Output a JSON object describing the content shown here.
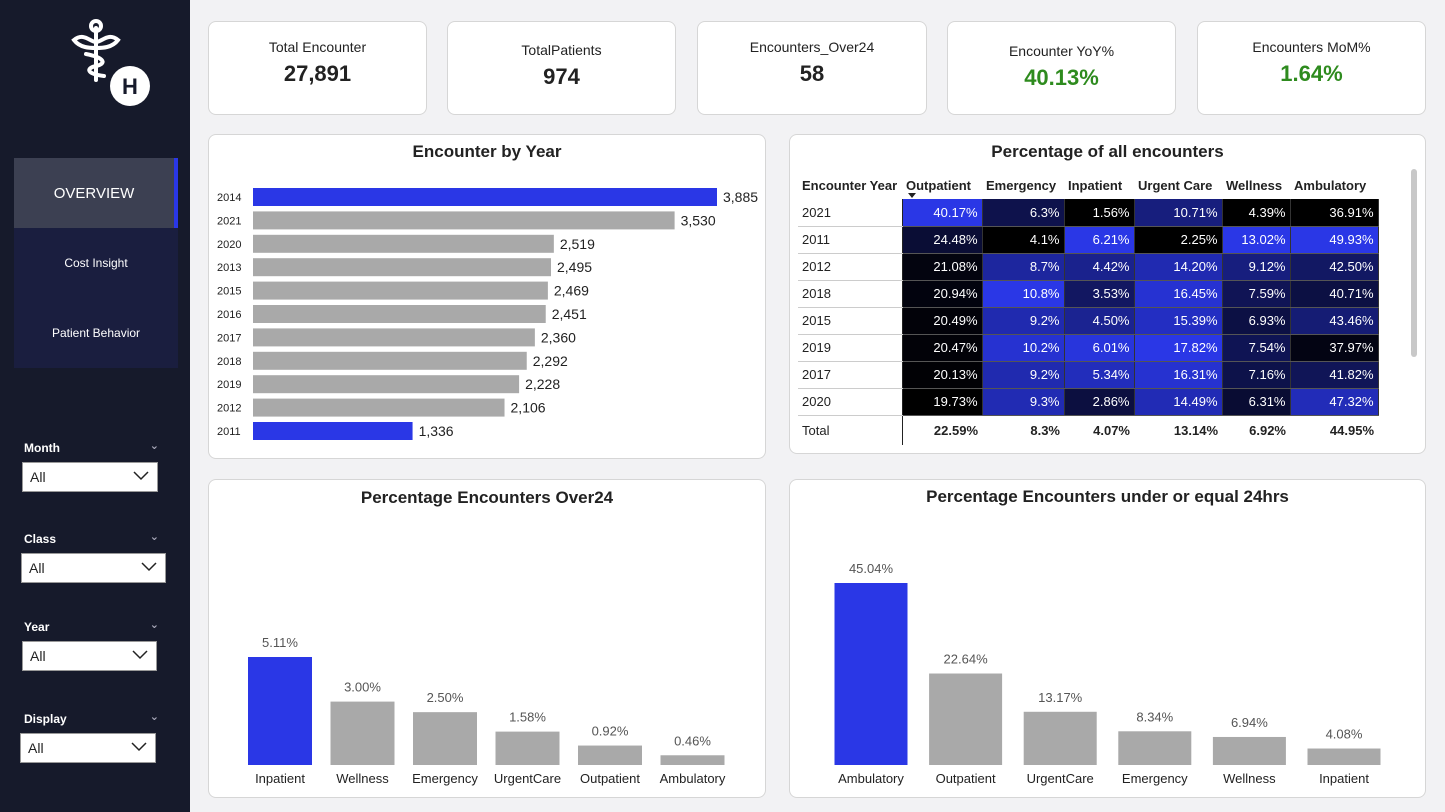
{
  "sidebar": {
    "nav": [
      {
        "label": "OVERVIEW"
      },
      {
        "label": "Cost Insight"
      },
      {
        "label": "Patient Behavior"
      }
    ],
    "filters": [
      {
        "label": "Month",
        "value": "All"
      },
      {
        "label": "Class",
        "value": "All"
      },
      {
        "label": "Year",
        "value": "All"
      },
      {
        "label": "Display",
        "value": "All"
      }
    ]
  },
  "kpis": [
    {
      "label": "Total Encounter",
      "value": "27,891"
    },
    {
      "label": "TotalPatients",
      "value": "974"
    },
    {
      "label": "Encounters_Over24",
      "value": "58"
    },
    {
      "label": "Encounter YoY%",
      "value": "40.13%"
    },
    {
      "label": "Encounters MoM%",
      "value": "1.64%"
    }
  ],
  "colors": {
    "highlight": "#2a37e6",
    "bar": "#a9a9a9",
    "positive": "#2e8b1e",
    "sidebar": "#161a2b"
  },
  "chart_data": [
    {
      "type": "bar",
      "orientation": "horizontal",
      "title": "Encounter by Year",
      "categories": [
        "2014",
        "2021",
        "2020",
        "2013",
        "2015",
        "2016",
        "2017",
        "2018",
        "2019",
        "2012",
        "2011"
      ],
      "values": [
        3885,
        3530,
        2519,
        2495,
        2469,
        2451,
        2360,
        2292,
        2228,
        2106,
        1336
      ],
      "labels": [
        "3,885",
        "3,530",
        "2,519",
        "2,495",
        "2,469",
        "2,451",
        "2,360",
        "2,292",
        "2,228",
        "2,106",
        "1,336"
      ],
      "highlighted": [
        "2014",
        "2011"
      ]
    },
    {
      "type": "table",
      "title": "Percentage of all encounters",
      "columns": [
        "Encounter Year",
        "Outpatient",
        "Emergency",
        "Inpatient",
        "Urgent Care",
        "Wellness",
        "Ambulatory"
      ],
      "rows": [
        [
          "2021",
          "40.17%",
          "6.3%",
          "1.56%",
          "10.71%",
          "4.39%",
          "36.91%"
        ],
        [
          "2011",
          "24.48%",
          "4.1%",
          "6.21%",
          "2.25%",
          "13.02%",
          "49.93%"
        ],
        [
          "2012",
          "21.08%",
          "8.7%",
          "4.42%",
          "14.20%",
          "9.12%",
          "42.50%"
        ],
        [
          "2018",
          "20.94%",
          "10.8%",
          "3.53%",
          "16.45%",
          "7.59%",
          "40.71%"
        ],
        [
          "2015",
          "20.49%",
          "9.2%",
          "4.50%",
          "15.39%",
          "6.93%",
          "43.46%"
        ],
        [
          "2019",
          "20.47%",
          "10.2%",
          "6.01%",
          "17.82%",
          "7.54%",
          "37.97%"
        ],
        [
          "2017",
          "20.13%",
          "9.2%",
          "5.34%",
          "16.31%",
          "7.16%",
          "41.82%"
        ],
        [
          "2020",
          "19.73%",
          "9.3%",
          "2.86%",
          "14.49%",
          "6.31%",
          "47.32%"
        ]
      ],
      "total": [
        "Total",
        "22.59%",
        "8.3%",
        "4.07%",
        "13.14%",
        "6.92%",
        "44.95%"
      ]
    },
    {
      "type": "bar",
      "title": "Percentage Encounters Over24",
      "categories": [
        "Inpatient",
        "Wellness",
        "Emergency",
        "UrgentCare",
        "Outpatient",
        "Ambulatory"
      ],
      "values": [
        5.11,
        3.0,
        2.5,
        1.58,
        0.92,
        0.46
      ],
      "labels": [
        "5.11%",
        "3.00%",
        "2.50%",
        "1.58%",
        "0.92%",
        "0.46%"
      ],
      "highlighted": [
        "Inpatient"
      ]
    },
    {
      "type": "bar",
      "title": "Percentage Encounters under or equal 24hrs",
      "categories": [
        "Ambulatory",
        "Outpatient",
        "UrgentCare",
        "Emergency",
        "Wellness",
        "Inpatient"
      ],
      "values": [
        45.04,
        22.64,
        13.17,
        8.34,
        6.94,
        4.08
      ],
      "labels": [
        "45.04%",
        "22.64%",
        "13.17%",
        "8.34%",
        "6.94%",
        "4.08%"
      ],
      "highlighted": [
        "Ambulatory"
      ]
    }
  ]
}
